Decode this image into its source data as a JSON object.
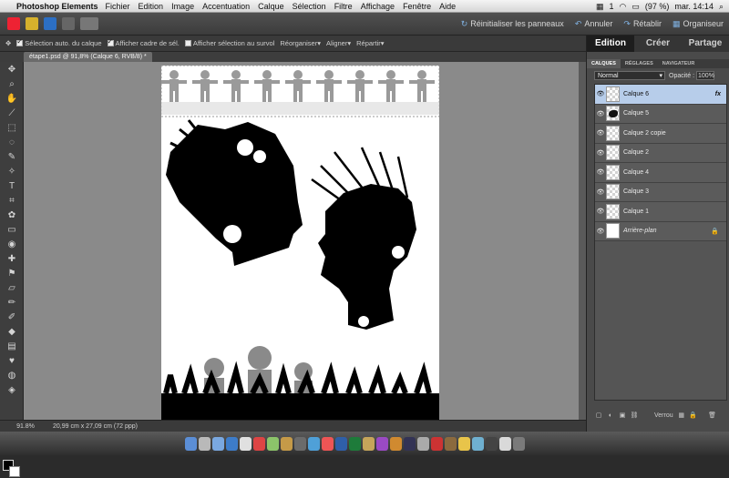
{
  "menubar": {
    "app": "Photoshop Elements",
    "items": [
      "Fichier",
      "Edition",
      "Image",
      "Accentuation",
      "Calque",
      "Sélection",
      "Filtre",
      "Affichage",
      "Fenêtre",
      "Aide"
    ],
    "status": {
      "one": "1",
      "battery": "(97 %)",
      "datetime": "mar. 14:14"
    }
  },
  "appbar": {
    "reset_panels": "Réinitialiser les panneaux",
    "undo": "Annuler",
    "redo": "Rétablir",
    "organizer": "Organiseur"
  },
  "options": {
    "auto_select": "Sélection auto. du calque",
    "show_bounding": "Afficher cadre de sél.",
    "show_highlight": "Afficher sélection au survol",
    "arrange": "Réorganiser",
    "align": "Aligner",
    "distribute": "Répartir"
  },
  "document": {
    "tab": "étape1.psd @ 91,8% (Calque 6, RVB/8) *"
  },
  "status": {
    "zoom": "91.8%",
    "info": "20,99 cm x 27,09 cm (72 ppp)"
  },
  "modes": [
    "Edition",
    "Créer",
    "Partage"
  ],
  "panel_tabs": [
    "CALQUES",
    "RÉGLAGES",
    "NAVIGATEUR"
  ],
  "blend": {
    "mode": "Normal",
    "opacity_label": "Opacité :",
    "opacity": "100%"
  },
  "layers": [
    {
      "name": "Calque 6",
      "selected": true,
      "fx": "fx"
    },
    {
      "name": "Calque 5"
    },
    {
      "name": "Calque 2 copie"
    },
    {
      "name": "Calque 2"
    },
    {
      "name": "Calque 4"
    },
    {
      "name": "Calque 3"
    },
    {
      "name": "Calque 1"
    },
    {
      "name": "Arrière-plan",
      "italic": true,
      "locked": true
    }
  ],
  "layer_footer": {
    "lock": "Verrou"
  },
  "colors": {
    "selected_layer": "#b7cdea",
    "canvas_bg": "#8a8a8a",
    "active_mode": "#1d1d1d",
    "accent": "#7fb0e0"
  }
}
